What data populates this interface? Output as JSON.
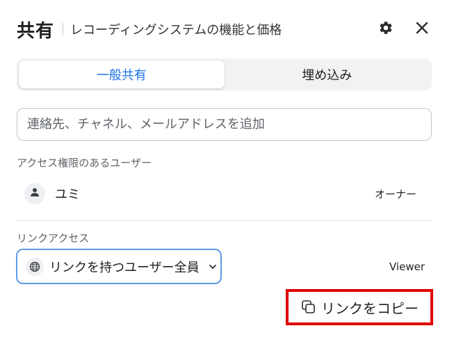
{
  "header": {
    "title": "共有",
    "subtitle": "レコーディングシステムの機能と価格"
  },
  "icons": {
    "settings": "gear-icon",
    "close": "close-icon",
    "user": "person-icon",
    "access": "globe-icon",
    "dropdown": "chevron-down-icon",
    "copy": "copy-icon"
  },
  "tabs": [
    {
      "label": "一般共有",
      "active": true
    },
    {
      "label": "埋め込み",
      "active": false
    }
  ],
  "search": {
    "placeholder": "連絡先、チャネル、メールアドレスを追加",
    "value": ""
  },
  "access_section": {
    "label": "アクセス権限のあるユーザー",
    "users": [
      {
        "name": "ユミ",
        "role": "オーナー"
      }
    ]
  },
  "link_section": {
    "label": "リンクアクセス",
    "selected": "リンクを持つユーザー全員",
    "permission": "Viewer",
    "copy_label": "リンクをコピー"
  },
  "colors": {
    "accent": "#1a73e8",
    "focus_border": "#5e9be6",
    "highlight": "#e00000"
  }
}
